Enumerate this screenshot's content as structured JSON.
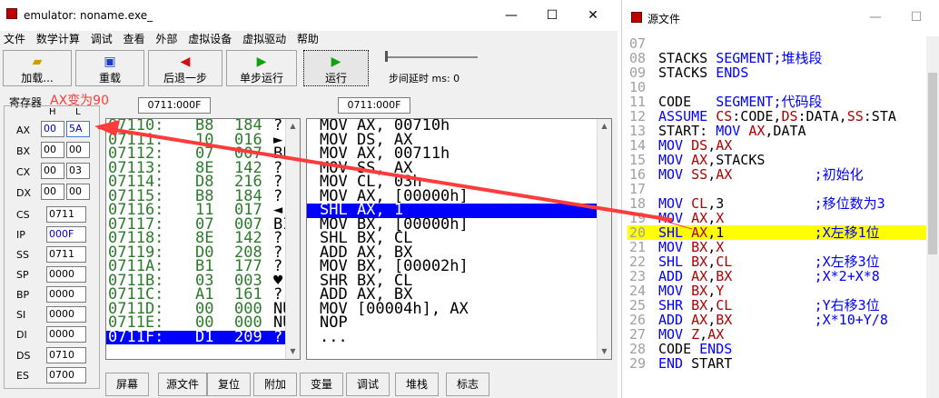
{
  "emulator": {
    "title": "emulator: noname.exe_",
    "menu": [
      "文件",
      "数学计算",
      "调试",
      "查看",
      "外部",
      "虚拟设备",
      "虚拟驱动",
      "帮助"
    ],
    "toolbar": {
      "load": "加载...",
      "reload": "重载",
      "back": "后退一步",
      "step": "单步运行",
      "run": "运行",
      "delay_label": "步间延时 ms: 0"
    },
    "registers_title": "寄存器",
    "annotation": "AX变为90",
    "h_label": "H",
    "l_label": "L",
    "regs8": [
      {
        "name": "AX",
        "h": "00",
        "l": "5A"
      },
      {
        "name": "BX",
        "h": "00",
        "l": "00"
      },
      {
        "name": "CX",
        "h": "00",
        "l": "03"
      },
      {
        "name": "DX",
        "h": "00",
        "l": "00"
      }
    ],
    "regs16": [
      {
        "name": "CS",
        "val": "0711"
      },
      {
        "name": "IP",
        "val": "000F"
      },
      {
        "name": "SS",
        "val": "0711"
      },
      {
        "name": "SP",
        "val": "0000"
      },
      {
        "name": "BP",
        "val": "0000"
      },
      {
        "name": "SI",
        "val": "0000"
      },
      {
        "name": "DI",
        "val": "0000"
      },
      {
        "name": "DS",
        "val": "0710"
      },
      {
        "name": "ES",
        "val": "0700"
      }
    ],
    "mem_address": "0711:000F",
    "disasm_address": "0711:000F",
    "memory": [
      {
        "addr": "07110:",
        "hex": "B8",
        "dec": "184",
        "chr": "?"
      },
      {
        "addr": "07111:",
        "hex": "10",
        "dec": "016",
        "chr": "►"
      },
      {
        "addr": "07112:",
        "hex": "07",
        "dec": "007",
        "chr": "BE"
      },
      {
        "addr": "07113:",
        "hex": "8E",
        "dec": "142",
        "chr": "?"
      },
      {
        "addr": "07114:",
        "hex": "D8",
        "dec": "216",
        "chr": "?"
      },
      {
        "addr": "07115:",
        "hex": "B8",
        "dec": "184",
        "chr": "?"
      },
      {
        "addr": "07116:",
        "hex": "11",
        "dec": "017",
        "chr": "◄"
      },
      {
        "addr": "07117:",
        "hex": "07",
        "dec": "007",
        "chr": "BI"
      },
      {
        "addr": "07118:",
        "hex": "8E",
        "dec": "142",
        "chr": "?"
      },
      {
        "addr": "07119:",
        "hex": "D0",
        "dec": "208",
        "chr": "?"
      },
      {
        "addr": "0711A:",
        "hex": "B1",
        "dec": "177",
        "chr": "?"
      },
      {
        "addr": "0711B:",
        "hex": "03",
        "dec": "003",
        "chr": "♥"
      },
      {
        "addr": "0711C:",
        "hex": "A1",
        "dec": "161",
        "chr": "?"
      },
      {
        "addr": "0711D:",
        "hex": "00",
        "dec": "000",
        "chr": "NU"
      },
      {
        "addr": "0711E:",
        "hex": "00",
        "dec": "000",
        "chr": "NU"
      },
      {
        "addr": "0711F:",
        "hex": "D1",
        "dec": "209",
        "chr": "?"
      }
    ],
    "disasm": [
      "MOV AX, 00710h",
      "MOV DS, AX",
      "MOV AX, 00711h",
      "MOV SS, AX",
      "MOV CL, 03h",
      "MOV AX, [00000h]",
      "SHL AX, 1",
      "MOV BX, [00000h]",
      "SHL BX, CL",
      "ADD AX, BX",
      "MOV BX, [00002h]",
      "SHR BX, CL",
      "ADD AX, BX",
      "MOV [00004h], AX",
      "NOP",
      "..."
    ],
    "bottom_buttons": [
      "屏幕",
      "源文件",
      "复位",
      "附加",
      "变量",
      "调试",
      "堆栈",
      "标志"
    ]
  },
  "source": {
    "title": "源文件",
    "lines": [
      {
        "n": "07",
        "t": ""
      },
      {
        "n": "08",
        "t": "STACKS SEGMENT;堆栈段"
      },
      {
        "n": "09",
        "t": "STACKS ENDS"
      },
      {
        "n": "10",
        "t": ""
      },
      {
        "n": "11",
        "t": "CODE   SEGMENT;代码段"
      },
      {
        "n": "12",
        "t": "ASSUME CS:CODE,DS:DATA,SS:STA"
      },
      {
        "n": "13",
        "t": "START: MOV AX,DATA"
      },
      {
        "n": "14",
        "t": "MOV DS,AX"
      },
      {
        "n": "15",
        "t": "MOV AX,STACKS"
      },
      {
        "n": "16",
        "t": "MOV SS,AX          ;初始化"
      },
      {
        "n": "17",
        "t": ""
      },
      {
        "n": "18",
        "t": "MOV CL,3           ;移位数为3"
      },
      {
        "n": "19",
        "t": "MOV AX,X"
      },
      {
        "n": "20",
        "t": "SHL AX,1           ;X左移1位"
      },
      {
        "n": "21",
        "t": "MOV BX,X"
      },
      {
        "n": "22",
        "t": "SHL BX,CL          ;X左移3位"
      },
      {
        "n": "23",
        "t": "ADD AX,BX          ;X*2+X*8"
      },
      {
        "n": "24",
        "t": "MOV BX,Y"
      },
      {
        "n": "25",
        "t": "SHR BX,CL          ;Y右移3位"
      },
      {
        "n": "26",
        "t": "ADD AX,BX          ;X*10+Y/8"
      },
      {
        "n": "27",
        "t": "MOV Z,AX"
      },
      {
        "n": "28",
        "t": "CODE ENDS"
      },
      {
        "n": "29",
        "t": "END START"
      }
    ],
    "highlight_line": "20"
  },
  "colors": {
    "highlight_blue": "#0000ff",
    "source_highlight": "#ffff00",
    "annotation_red": "#ff3b3b",
    "mem_green": "#2d7a2d"
  }
}
